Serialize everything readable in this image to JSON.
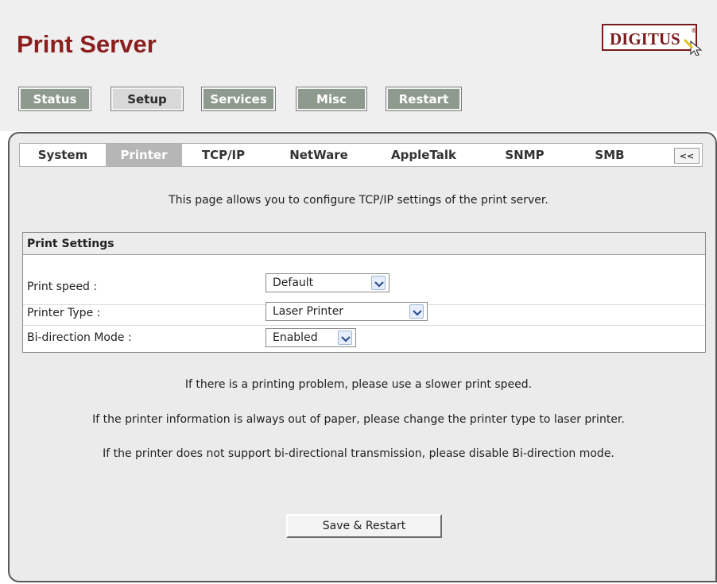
{
  "header": {
    "title": "Print Server",
    "logo_text": "DIGITUS",
    "logo_mark": "®"
  },
  "nav": {
    "items": [
      {
        "label": "Status",
        "active": false
      },
      {
        "label": "Setup",
        "active": true
      },
      {
        "label": "Services",
        "active": false
      },
      {
        "label": "Misc",
        "active": false
      },
      {
        "label": "Restart",
        "active": false
      }
    ]
  },
  "tabs": {
    "items": [
      {
        "label": "System",
        "active": false
      },
      {
        "label": "Printer",
        "active": true
      },
      {
        "label": "TCP/IP",
        "active": false
      },
      {
        "label": "NetWare",
        "active": false
      },
      {
        "label": "AppleTalk",
        "active": false
      },
      {
        "label": "SNMP",
        "active": false
      },
      {
        "label": "SMB",
        "active": false
      }
    ],
    "collapse_label": "<<"
  },
  "intro": "This page allows you to configure TCP/IP settings of the print server.",
  "settings": {
    "title": "Print Settings",
    "fields": [
      {
        "label": "Print speed :",
        "value": "Default"
      },
      {
        "label": "Printer Type :",
        "value": "Laser Printer"
      },
      {
        "label": "Bi-direction Mode :",
        "value": "Enabled"
      }
    ]
  },
  "notes": [
    "If there is a printing problem, please use a slower print speed.",
    "If the printer information is always out of paper, please change the printer type to laser printer.",
    "If the printer does not support bi-directional transmission, please disable Bi-direction mode."
  ],
  "actions": {
    "save_label": "Save & Restart"
  },
  "icons": {
    "dropdown": "chevron-down-icon",
    "logo_cursor": "pointer-cursor-icon"
  },
  "colors": {
    "title": "#8b1e1e",
    "nav_inactive_bg": "#8f9a8f",
    "tab_active_bg": "#b6b6b6",
    "logo_text": "#7a1a1a",
    "logo_accent": "#e3c21a"
  }
}
